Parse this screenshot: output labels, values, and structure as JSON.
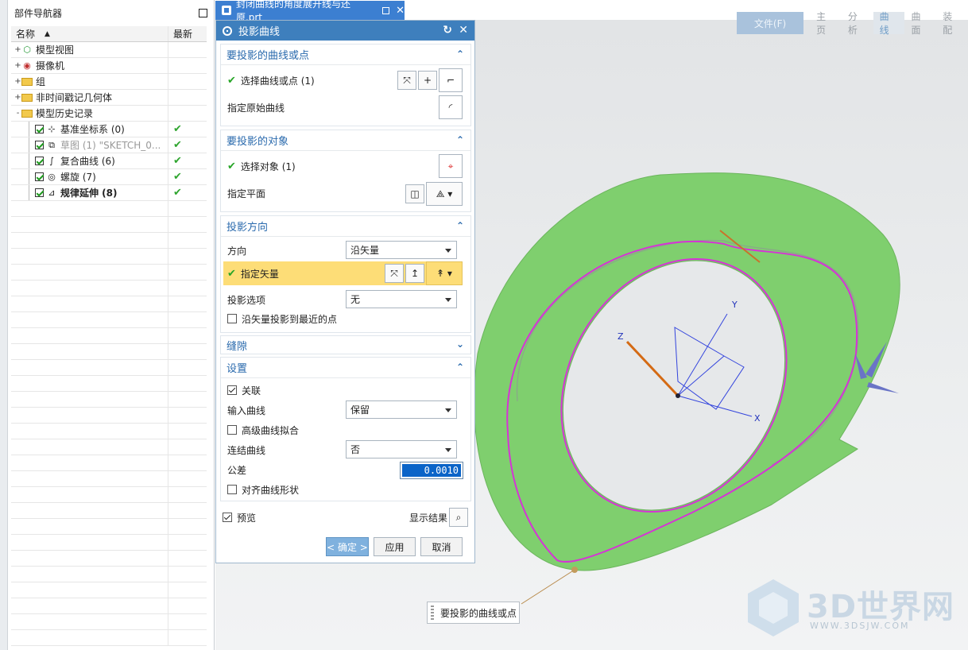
{
  "navigator": {
    "title": "部件导航器",
    "col_name": "名称",
    "col_latest": "最新",
    "rows": [
      {
        "label": "模型视图",
        "indent": 0,
        "expand": "+",
        "icon": "model-views-icon",
        "latest": "",
        "check": false
      },
      {
        "label": "摄像机",
        "indent": 0,
        "expand": "+",
        "icon": "camera-icon",
        "latest": "",
        "check": false
      },
      {
        "label": "组",
        "indent": 0,
        "expand": "+",
        "icon": "folder-icon",
        "latest": "",
        "check": false
      },
      {
        "label": "非时间戳记几何体",
        "indent": 0,
        "expand": "+",
        "icon": "folder-icon",
        "latest": "",
        "check": false
      },
      {
        "label": "模型历史记录",
        "indent": 0,
        "expand": "-",
        "icon": "folder-icon",
        "latest": "",
        "check": false
      },
      {
        "label": "基准坐标系 (0)",
        "indent": 1,
        "expand": "",
        "icon": "datum-csys-icon",
        "latest": "✔",
        "check": true
      },
      {
        "label": "草图 (1) \"SKETCH_0...",
        "indent": 1,
        "expand": "",
        "icon": "sketch-icon",
        "latest": "✔",
        "check": true,
        "dim": true
      },
      {
        "label": "复合曲线 (6)",
        "indent": 1,
        "expand": "",
        "icon": "composite-curve-icon",
        "latest": "✔",
        "check": true
      },
      {
        "label": "螺旋 (7)",
        "indent": 1,
        "expand": "",
        "icon": "helix-icon",
        "latest": "✔",
        "check": true
      },
      {
        "label": "规律延伸 (8)",
        "indent": 1,
        "expand": "",
        "icon": "law-extension-icon",
        "latest": "✔",
        "check": true,
        "bold": true
      }
    ]
  },
  "tab": {
    "title": "封闭曲线的角度展开线与还原.prt"
  },
  "ribbon": {
    "file": "文件(F)",
    "tabs": [
      "主页",
      "分析",
      "曲线",
      "曲面",
      "装配"
    ],
    "active": "曲线"
  },
  "dialog": {
    "title": "投影曲线",
    "sec1": {
      "title": "要投影的曲线或点",
      "select_label": "选择曲线或点 (1)",
      "original_label": "指定原始曲线"
    },
    "sec2": {
      "title": "要投影的对象",
      "select_label": "选择对象 (1)",
      "plane_label": "指定平面"
    },
    "sec3": {
      "title": "投影方向",
      "direction_label": "方向",
      "direction_value": "沿矢量",
      "vector_label": "指定矢量",
      "option_label": "投影选项",
      "option_value": "无",
      "nearest_label": "沿矢量投影到最近的点"
    },
    "sec4": {
      "title": "缝隙"
    },
    "sec5": {
      "title": "设置",
      "assoc_label": "关联",
      "input_label": "输入曲线",
      "input_value": "保留",
      "hq_label": "高级曲线拟合",
      "join_label": "连结曲线",
      "join_value": "否",
      "tol_label": "公差",
      "tol_value": "0.0010",
      "align_label": "对齐曲线形状"
    },
    "preview_label": "预览",
    "show_result_label": "显示结果",
    "ok_label": "< 确定 >",
    "apply_label": "应用",
    "cancel_label": "取消"
  },
  "viewport": {
    "tooltip": "要投影的曲线或点",
    "axis_x": "X",
    "axis_y": "Y",
    "axis_z": "Z",
    "watermark_brand": "3D世界网",
    "watermark_url": "WWW.3DSJW.COM"
  },
  "colors": {
    "dialog_title": "#3e7fbd",
    "tab": "#3c7fd1",
    "part_face": "#7fcf6e",
    "curve": "#d633d6",
    "highlight": "#fddd77"
  }
}
